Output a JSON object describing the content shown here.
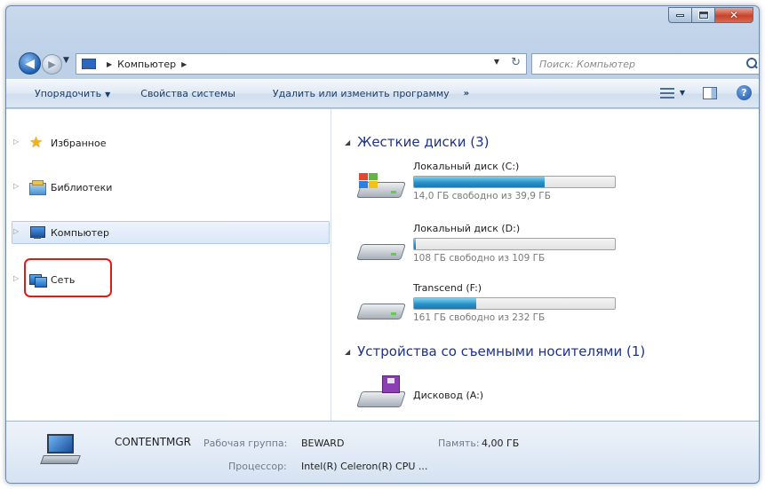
{
  "address": {
    "crumb": "Компьютер",
    "search_placeholder": "Поиск: Компьютер"
  },
  "toolbar": {
    "organize": "Упорядочить",
    "system_properties": "Свойства системы",
    "uninstall": "Удалить или изменить программу",
    "more": "»"
  },
  "nav": {
    "favorites": "Избранное",
    "libraries": "Библиотеки",
    "computer": "Компьютер",
    "network": "Сеть"
  },
  "groups": {
    "hard_drives": "Жесткие диски (3)",
    "removable": "Устройства со съемными носителями (1)"
  },
  "drives": [
    {
      "name": "Локальный диск (C:)",
      "free_text": "14,0 ГБ свободно из 39,9 ГБ",
      "used_fraction": 0.65
    },
    {
      "name": "Локальный диск (D:)",
      "free_text": "108 ГБ свободно из 109 ГБ",
      "used_fraction": 0.01
    },
    {
      "name": "Transcend (F:)",
      "free_text": "161 ГБ свободно из 232 ГБ",
      "used_fraction": 0.31
    }
  ],
  "removable_drive": {
    "name": "Дисковод (A:)"
  },
  "details": {
    "computer_name": "CONTENTMGR",
    "workgroup_label": "Рабочая группа:",
    "workgroup_value": "BEWARD",
    "memory_label": "Память:",
    "memory_value": "4,00 ГБ",
    "processor_label": "Процессор:",
    "processor_value": "Intel(R) Celeron(R) CPU ..."
  },
  "colors": {
    "highlight_ring": "#e01a1a",
    "bar_fill": "#2991c6",
    "group_header": "#1e3287"
  }
}
